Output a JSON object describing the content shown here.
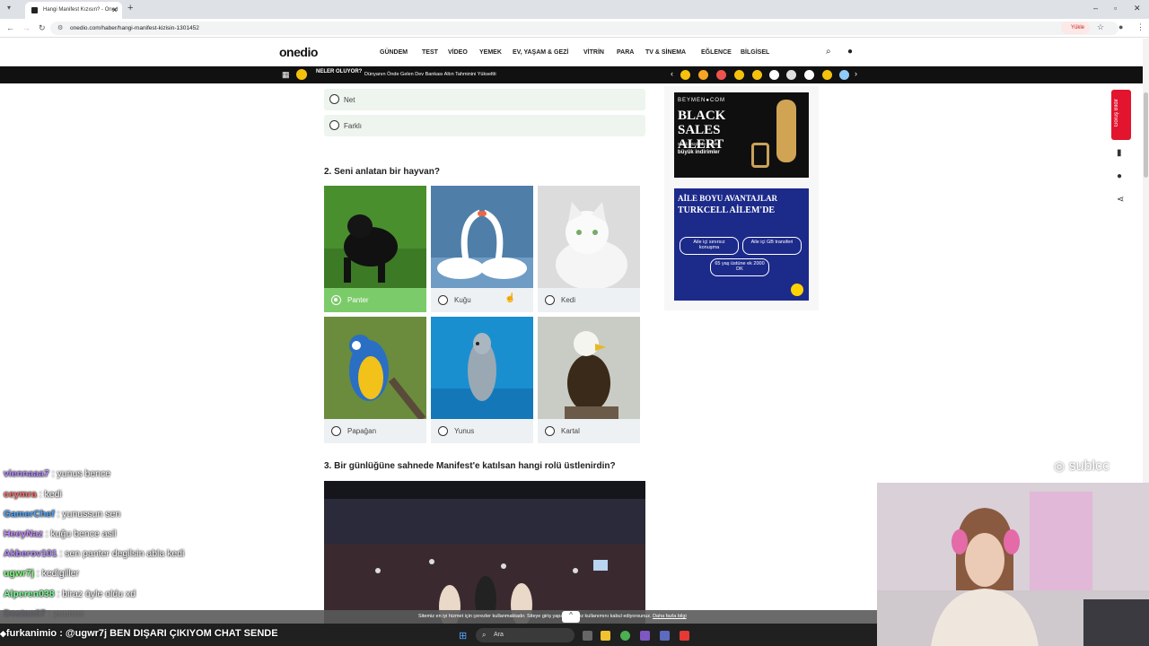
{
  "browser": {
    "tab_title": "Hangi Manifest Kızısın? - Oned",
    "url": "onedio.com/haber/hangi-manifest-kizisin-1301452",
    "upload_label": "Yükle"
  },
  "site": {
    "logo": "onedio",
    "menu": [
      "GÜNDEM",
      "TEST",
      "VİDEO",
      "YEMEK",
      "EV, YAŞAM & GEZİ",
      "VİTRİN",
      "PARA",
      "TV & SİNEMA",
      "EĞLENCE",
      "BİLGİSEL"
    ],
    "ticker_label": "NELER OLUYOR?",
    "ticker_news": "Dünyanın Önde Gelen Dev Bankası Altın Tahminini Yükseltti"
  },
  "quiz": {
    "q1_options": [
      "Net",
      "Farklı"
    ],
    "q2_title": "2. Seni anlatan bir hayvan?",
    "q2_options": [
      "Panter",
      "Kuğu",
      "Kedi",
      "Papağan",
      "Yunus",
      "Kartal"
    ],
    "q2_selected": "Panter",
    "q3_title": "3. Bir günlüğüne sahnede Manifest'e katılsan hangi rolü üstlenirdin?"
  },
  "ads": {
    "ad1_brand": "BEYMEN●COM",
    "ad1_headline": "BLACK SALES ALERT",
    "ad1_sub1": "Seçili ürünlerde sepette",
    "ad1_sub2": "büyük indirimler",
    "ad2_title": "AİLE BOYU AVANTAJLAR",
    "ad2_subtitle": "TURKCELL AİLEM'DE",
    "ad2_pill1": "Aile içi sınırsız konuşma",
    "ad2_pill2": "Aile içi GB transferi",
    "ad2_pill3": "65 yaş üstüne ek 2000 DK"
  },
  "sidebar": {
    "notify_label": "Görüş Bildir"
  },
  "stream": {
    "chat": [
      {
        "user": "viennaaa7",
        "msg": " : yunus bence",
        "color": "#b48cff"
      },
      {
        "user": "ceymra",
        "msg": " : kedi",
        "color": "#ff6b6b"
      },
      {
        "user": "GamerChef",
        "msg": " : yunussun sen",
        "color": "#4da3ff"
      },
      {
        "user": "HeeyNaz",
        "msg": " : kuğu bence asil",
        "color": "#c58bff"
      },
      {
        "user": "Akberov101",
        "msg": " : sen panter degilsin abla kedi",
        "color": "#b48cff"
      },
      {
        "user": "ugwr7j",
        "msg": " : kedigiller",
        "color": "#7cff7c"
      },
      {
        "user": "Alperen038",
        "msg": " : biraz öyle oldu xd",
        "color": "#7cff9a"
      },
      {
        "user": "Destan67",
        "msg": " : yuunus",
        "color": "#b48cff"
      }
    ],
    "last_chat_user": "furkanimio",
    "last_chat_msg": " : @ugwr7j BEN DIŞARI ÇIKIYOM CHAT SENDE",
    "watermark": "sublcc"
  },
  "cookie": {
    "text": "Sitemiz en iyi hizmet için çerezler kullanmaktadır. Siteye giriş yaparak çerez kullanımını kabul ediyorsunuz.",
    "link": "Daha fazla bilgi"
  },
  "taskbar": {
    "search_label": "Ara"
  }
}
